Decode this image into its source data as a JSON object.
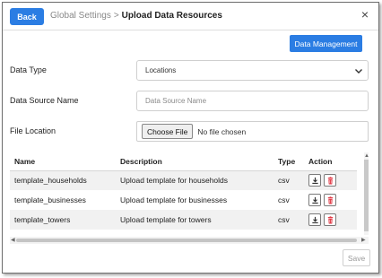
{
  "header": {
    "back_label": "Back",
    "breadcrumb_parent": "Global Settings",
    "breadcrumb_separator": ">",
    "breadcrumb_current": "Upload Data Resources",
    "close_glyph": "×"
  },
  "toolbar": {
    "data_management_label": "Data Management"
  },
  "form": {
    "data_type": {
      "label": "Data Type",
      "selected": "Locations"
    },
    "data_source_name": {
      "label": "Data Source Name",
      "value": "",
      "placeholder": "Data Source Name"
    },
    "file_location": {
      "label": "File Location",
      "button_label": "Choose File",
      "status": "No file chosen"
    }
  },
  "table": {
    "headers": {
      "name": "Name",
      "description": "Description",
      "type": "Type",
      "action": "Action"
    },
    "rows": [
      {
        "name": "template_households",
        "description": "Upload template for households",
        "type": "csv"
      },
      {
        "name": "template_businesses",
        "description": "Upload template for businesses",
        "type": "csv"
      },
      {
        "name": "template_towers",
        "description": "Upload template for towers",
        "type": "csv"
      }
    ]
  },
  "footer": {
    "save_label": "Save"
  },
  "colors": {
    "accent": "#2b7de3",
    "delete_icon": "#e0303d",
    "download_icon": "#333333"
  },
  "icons": {
    "close": "close-icon",
    "chevron": "chevron-down-icon",
    "download": "download-icon",
    "delete": "trash-icon"
  }
}
